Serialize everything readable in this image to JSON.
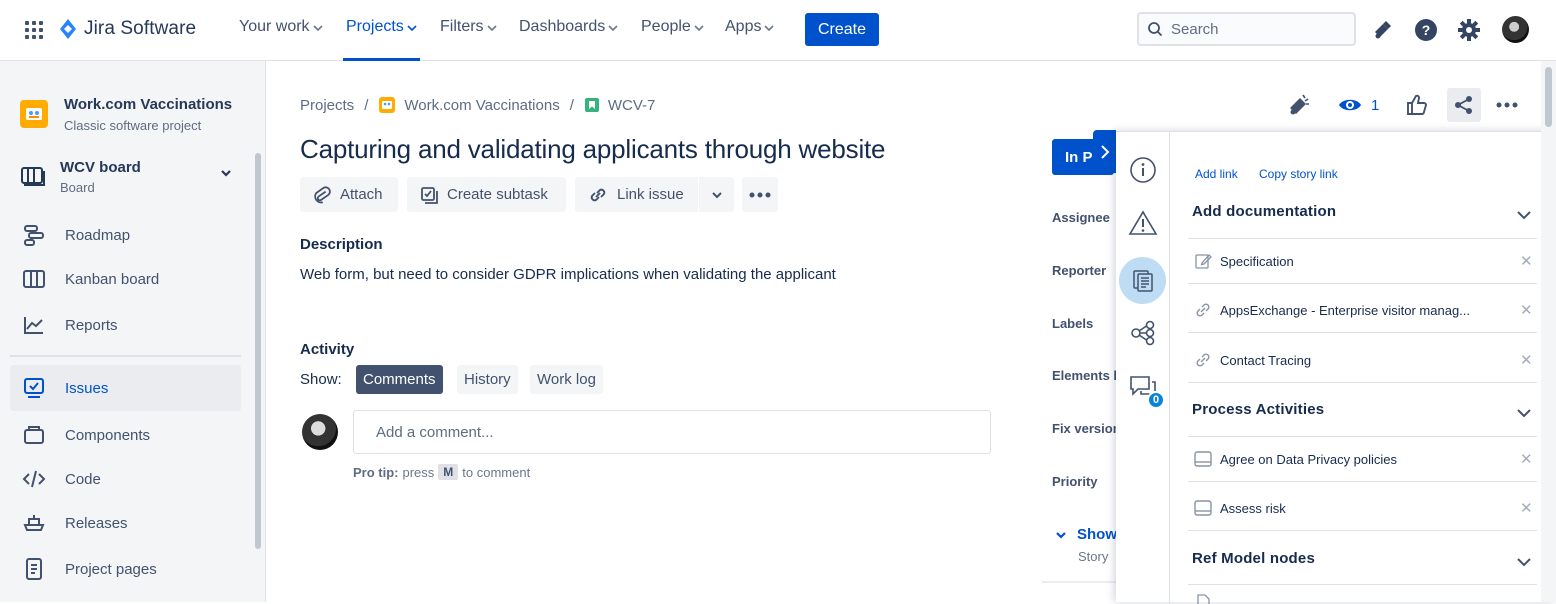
{
  "nav": {
    "logo_text": "Jira Software",
    "items": [
      {
        "label": "Your work"
      },
      {
        "label": "Projects"
      },
      {
        "label": "Filters"
      },
      {
        "label": "Dashboards"
      },
      {
        "label": "People"
      },
      {
        "label": "Apps"
      }
    ],
    "create_label": "Create",
    "search_placeholder": "Search"
  },
  "sidebar": {
    "project_name": "Work.com Vaccinations",
    "project_type": "Classic software project",
    "board_name": "WCV board",
    "board_type": "Board",
    "items": [
      {
        "label": "Roadmap",
        "icon": "roadmap-icon"
      },
      {
        "label": "Kanban board",
        "icon": "kanban-icon"
      },
      {
        "label": "Reports",
        "icon": "reports-icon"
      },
      {
        "label": "Issues",
        "icon": "issues-icon"
      },
      {
        "label": "Components",
        "icon": "components-icon"
      },
      {
        "label": "Code",
        "icon": "code-icon"
      },
      {
        "label": "Releases",
        "icon": "releases-icon"
      },
      {
        "label": "Project pages",
        "icon": "pages-icon"
      }
    ]
  },
  "issue": {
    "breadcrumbs": [
      "Projects",
      "Work.com Vaccinations",
      "WCV-7"
    ],
    "title": "Capturing and validating applicants through website",
    "actions": [
      "Attach",
      "Create subtask",
      "Link issue"
    ],
    "description_heading": "Description",
    "description": "Web form, but need to consider GDPR implications when validating the applicant",
    "activity_heading": "Activity",
    "show_label": "Show:",
    "tabs": [
      "Comments",
      "History",
      "Work log"
    ],
    "comment_placeholder": "Add a comment...",
    "protip_label": "Pro tip:",
    "protip_press": "press",
    "protip_key": "M",
    "protip_suffix": "to comment",
    "watchers": "1",
    "status": "In P",
    "fields": [
      "Assignee",
      "Reporter",
      "Labels",
      "Elements l",
      "Fix version",
      "Priority"
    ],
    "show_more": "Show",
    "issue_type": "Story"
  },
  "panel": {
    "links": [
      "Add link",
      "Copy story link"
    ],
    "badge_count": "0",
    "sections": [
      {
        "title": "Add documentation",
        "rows": [
          {
            "label": "Specification",
            "icon": "edit-doc-icon"
          },
          {
            "label": "AppsExchange - Enterprise visitor manag...",
            "icon": "link-icon"
          },
          {
            "label": "Contact Tracing",
            "icon": "link-icon"
          }
        ]
      },
      {
        "title": "Process Activities",
        "rows": [
          {
            "label": "Agree on Data Privacy policies",
            "icon": "activity-icon"
          },
          {
            "label": "Assess risk",
            "icon": "activity-icon"
          }
        ]
      },
      {
        "title": "Ref Model nodes",
        "rows": []
      }
    ]
  },
  "colors": {
    "brand": "#0052CC",
    "text": "#172B4D",
    "subtle": "#42526E",
    "sidebar_bg": "#F4F5F7"
  }
}
